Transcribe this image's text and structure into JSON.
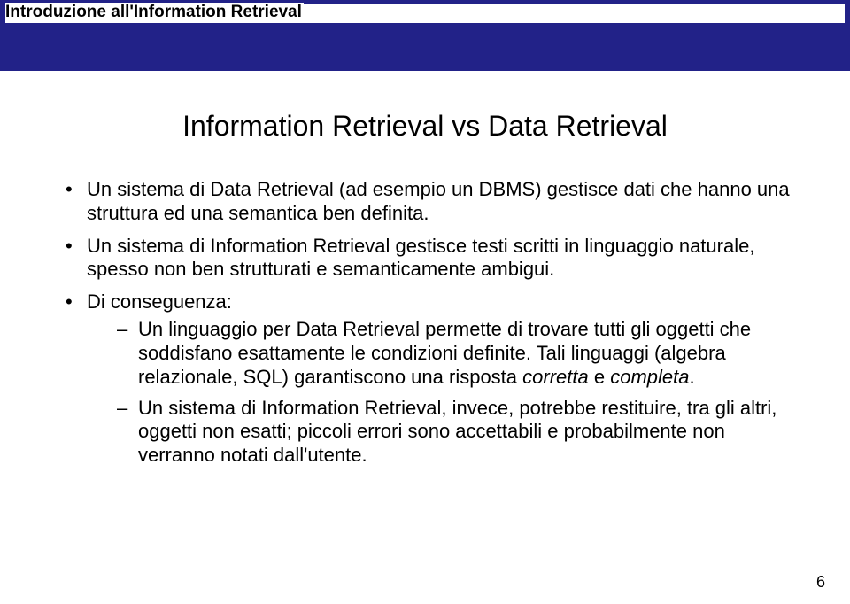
{
  "header": {
    "course_title": "Introduzione all'Information Retrieval"
  },
  "slide": {
    "title": "Information Retrieval vs Data Retrieval",
    "bullets": [
      {
        "text": "Un sistema di Data Retrieval (ad esempio un DBMS) gestisce dati che hanno una struttura ed una semantica ben definita."
      },
      {
        "text": "Un sistema di Information Retrieval gestisce testi scritti in linguaggio naturale, spesso non ben strutturati e semanticamente ambigui."
      },
      {
        "text": "Di conseguenza:",
        "sub": [
          {
            "pre": "Un linguaggio per Data Retrieval permette di trovare tutti gli oggetti che soddisfano esattamente le condizioni definite. Tali linguaggi (algebra relazionale, SQL) garantiscono una risposta ",
            "em1": "corretta",
            "mid": " e ",
            "em2": "completa",
            "post": "."
          },
          {
            "pre": "Un sistema di Information Retrieval, invece, potrebbe restituire, tra gli altri, oggetti non esatti; piccoli errori sono accettabili e probabilmente non verranno notati dall'utente.",
            "em1": "",
            "mid": "",
            "em2": "",
            "post": ""
          }
        ]
      }
    ]
  },
  "page_number": "6"
}
